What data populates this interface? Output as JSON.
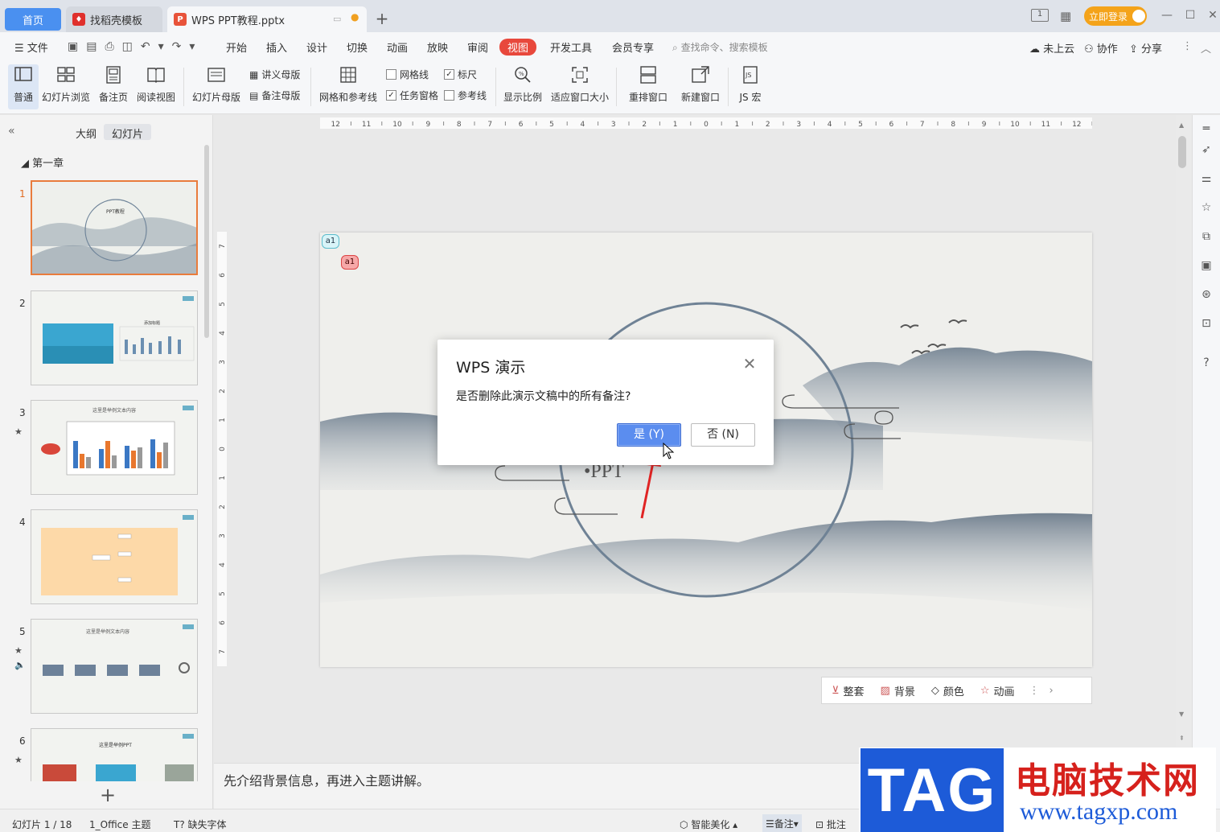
{
  "tabs": {
    "home": "首页",
    "template": "找稻壳模板",
    "document": "WPS PPT教程.pptx",
    "login": "立即登录"
  },
  "menu": {
    "file": "文件",
    "items": [
      "开始",
      "插入",
      "设计",
      "切换",
      "动画",
      "放映",
      "审阅",
      "视图",
      "开发工具",
      "会员专享"
    ],
    "search": "查找命令、搜索模板",
    "cloud": "未上云",
    "collab": "协作",
    "share": "分享"
  },
  "ribbon": {
    "normal": "普通",
    "slide_browse": "幻灯片浏览",
    "notes_page": "备注页",
    "reading_view": "阅读视图",
    "slide_master": "幻灯片母版",
    "handout_master": "讲义母版",
    "notes_master": "备注母版",
    "grid_guides": "网格和参考线",
    "gridlines": "网格线",
    "ruler": "标尺",
    "task_pane": "任务窗格",
    "guides": "参考线",
    "zoom": "显示比例",
    "fit_window": "适应窗口大小",
    "arrange": "重排窗口",
    "new_window": "新建窗口",
    "macro": "JS 宏"
  },
  "checks": {
    "gridlines": false,
    "ruler": true,
    "task_pane": true,
    "guides": false
  },
  "left_panel": {
    "tab_outline": "大纲",
    "tab_slides": "幻灯片",
    "section": "第一章",
    "slides": [
      {
        "num": "1",
        "caption": "PPT教程"
      },
      {
        "num": "2",
        "caption": "添加标题"
      },
      {
        "num": "3",
        "caption": "这里是举例文本内容"
      },
      {
        "num": "4",
        "caption": ""
      },
      {
        "num": "5",
        "caption": "这里是举例文本内容"
      },
      {
        "num": "6",
        "caption": "这里是举例PPT"
      }
    ]
  },
  "slide": {
    "text": "•PPT",
    "comment1": "a1",
    "comment2": "a1"
  },
  "slide_toolbar": {
    "layout": "整套",
    "background": "背景",
    "color": "颜色",
    "animation": "动画"
  },
  "ruler_h_labels": [
    "12",
    "11",
    "10",
    "9",
    "8",
    "7",
    "6",
    "5",
    "4",
    "3",
    "2",
    "1",
    "0",
    "1",
    "2",
    "3",
    "4",
    "5",
    "6",
    "7",
    "8",
    "9",
    "10",
    "11",
    "12"
  ],
  "ruler_v_labels": [
    "7",
    "6",
    "5",
    "4",
    "3",
    "2",
    "1",
    "0",
    "1",
    "2",
    "3",
    "4",
    "5",
    "6",
    "7"
  ],
  "notes": "先介绍背景信息，再进入主题讲解。",
  "dialog": {
    "title": "WPS 演示",
    "message": "是否删除此演示文稿中的所有备注?",
    "yes": "是 (Y)",
    "no": "否 (N)"
  },
  "status": {
    "slide_count": "幻灯片 1 / 18",
    "theme": "1_Office 主题",
    "missing_font": "缺失字体",
    "smart": "智能美化",
    "notes": "备注",
    "comment": "批注"
  },
  "watermark": {
    "tag": "TAG",
    "site_name": "电脑技术网",
    "url": "www.tagxp.com"
  },
  "colors": {
    "accent_view": "#e8483c",
    "home_tab": "#4a90f0",
    "login": "#f4a31a",
    "yes_button": "#5b8def",
    "arrow": "#e02424"
  }
}
